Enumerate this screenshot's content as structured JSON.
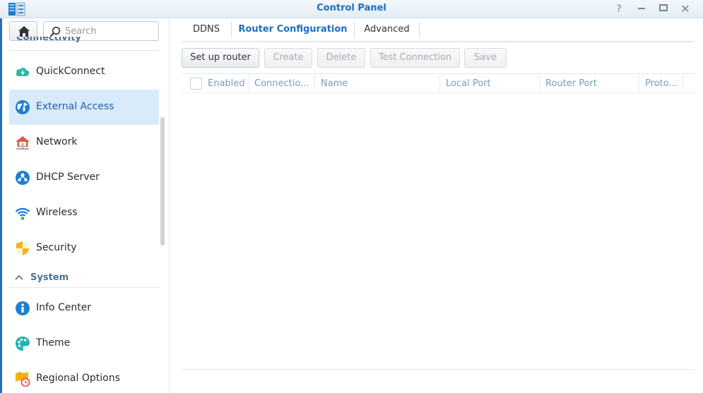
{
  "window": {
    "title": "Control Panel",
    "help_label": "?",
    "close_label": "✕",
    "accent": "#1c6fbf"
  },
  "sidebar": {
    "search_placeholder": "Search",
    "category_connectivity": "Connectivity",
    "category_system": "System",
    "items": [
      {
        "label": "QuickConnect",
        "icon": "quickconnect-icon"
      },
      {
        "label": "External Access",
        "icon": "external-access-globe-icon",
        "active": true
      },
      {
        "label": "Network",
        "icon": "network-house-icon"
      },
      {
        "label": "DHCP Server",
        "icon": "dhcp-server-icon"
      },
      {
        "label": "Wireless",
        "icon": "wireless-icon"
      },
      {
        "label": "Security",
        "icon": "security-shield-icon"
      },
      {
        "label": "Info Center",
        "icon": "info-center-icon"
      },
      {
        "label": "Theme",
        "icon": "theme-palette-icon"
      },
      {
        "label": "Regional Options",
        "icon": "regional-options-icon"
      }
    ]
  },
  "tabs": [
    {
      "label": "DDNS"
    },
    {
      "label": "Router Configuration",
      "active": true
    },
    {
      "label": "Advanced"
    }
  ],
  "toolbar": {
    "setup_router": "Set up router",
    "create": "Create",
    "delete": "Delete",
    "test_connection": "Test Connection",
    "save": "Save"
  },
  "grid": {
    "columns": [
      "Enabled",
      "Connectio...",
      "Name",
      "Local Port",
      "Router Port",
      "Proto..."
    ],
    "rows": []
  }
}
